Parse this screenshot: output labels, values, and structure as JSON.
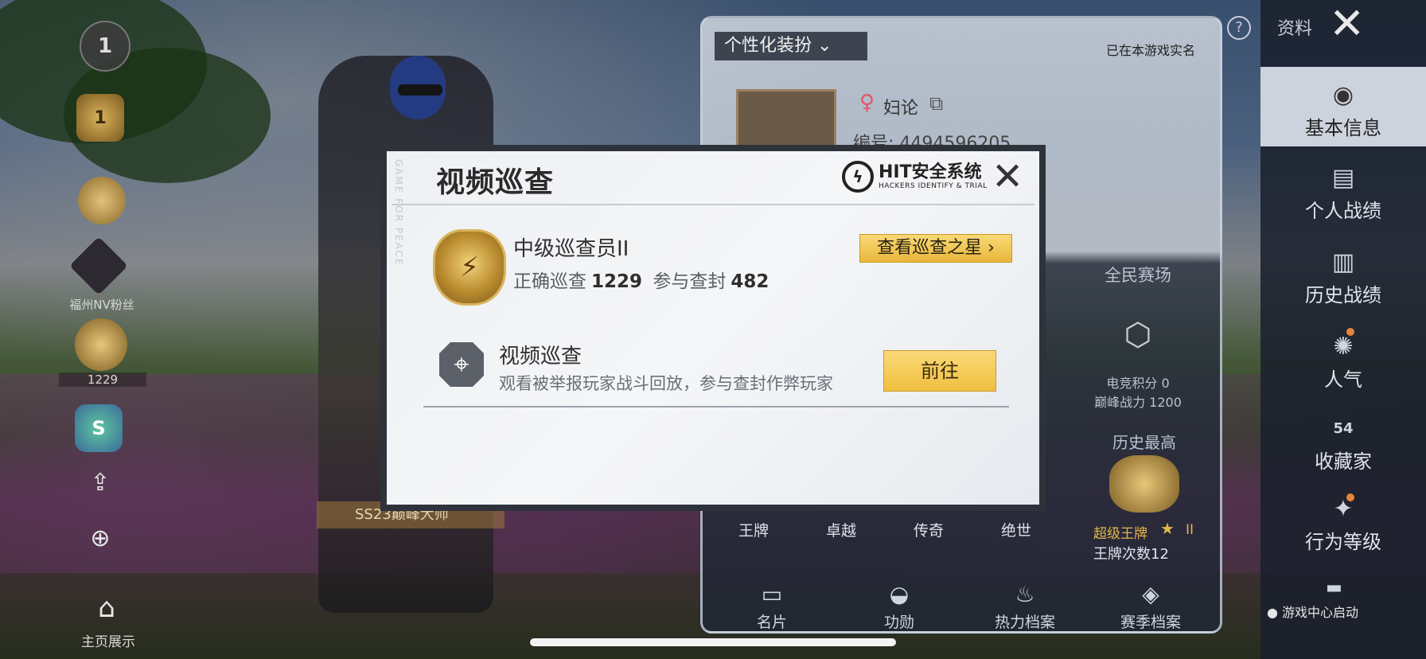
{
  "left": {
    "level_badge": "1",
    "rank_badge": "1",
    "fan_label": "福州NV粉丝",
    "patrol_count": "1229",
    "season_badge": "S",
    "home_label": "主页展示"
  },
  "banner_text": "SS23巅峰大师",
  "profile": {
    "section_title": "个性化装扮",
    "real_name_status": "已在本游戏实名",
    "nickname": "妇论",
    "uid": "编号: 4494596205",
    "mode_label": "全民赛场",
    "esports_score": "电竞积分 0",
    "peak_power": "巅峰战力 1200",
    "history_high_label": "历史最高",
    "tier_name": "超级王牌",
    "tier_level": "II",
    "ace_count": "王牌次数12",
    "ranks": [
      "王牌",
      "卓越",
      "传奇",
      "绝世"
    ],
    "bottom_tabs": [
      {
        "label": "名片",
        "icon": "card-icon"
      },
      {
        "label": "功勋",
        "icon": "merit-icon"
      },
      {
        "label": "热力档案",
        "icon": "flame-icon"
      },
      {
        "label": "赛季档案",
        "icon": "season-icon"
      }
    ]
  },
  "sidebar": {
    "title": "资料",
    "help": "?",
    "items": [
      {
        "label": "基本信息",
        "icon": "user-info-icon"
      },
      {
        "label": "个人战绩",
        "icon": "stats-icon"
      },
      {
        "label": "历史战绩",
        "icon": "history-icon"
      },
      {
        "label": "人气",
        "icon": "popularity-icon"
      },
      {
        "label": "收藏家",
        "icon": "collector-icon"
      },
      {
        "label": "行为等级",
        "icon": "behavior-icon"
      }
    ],
    "collector_level": "54",
    "game_center": "游戏中心启动"
  },
  "modal": {
    "title": "视频巡查",
    "hit_name": "HIT安全系统",
    "hit_sub": "HACKERS IDENTIFY & TRIAL",
    "rank_name": "中级巡查员II",
    "correct_label": "正确巡查",
    "correct_value": "1229",
    "ban_label": "参与查封",
    "ban_value": "482",
    "star_button": "查看巡查之星 ›",
    "feature_title": "视频巡查",
    "feature_desc": "观看被举报玩家战斗回放，参与查封作弊玩家",
    "go_button": "前往",
    "side_text": "GAME FOR PEACE"
  },
  "colors": {
    "button_gold": "#f0bf3f",
    "modal_bg": "#f2f3f6",
    "sidebar_bg": "#1a202c",
    "active_item_bg": "#dce2ea",
    "notify_dot": "#e8843a",
    "tier_gold": "#e2b64a"
  }
}
